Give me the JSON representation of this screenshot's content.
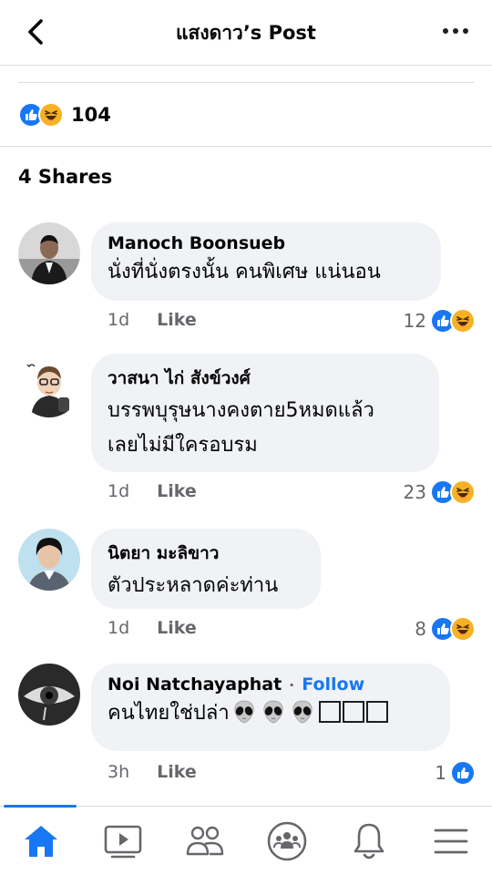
{
  "header": {
    "title": "แสงดาว’s Post",
    "back_icon": "chevron-left-icon",
    "more_icon": "more-horizontal-icon"
  },
  "post": {
    "reaction_count": "104",
    "reaction_types": [
      "like",
      "haha"
    ],
    "shares_label": "4 Shares"
  },
  "comments": [
    {
      "author": "Manoch Boonsueb",
      "lines": [
        "นั่งที่นั่งตรงนั้น คนพิเศษ แน่นอน"
      ],
      "time": "1d",
      "like_label": "Like",
      "reaction_count": "12",
      "reaction_types": [
        "like",
        "haha"
      ]
    },
    {
      "author": "วาสนา ไก่ สังข์วงศ์",
      "lines": [
        "บรรพบุรุษนางคงตาย5หมดแล้ว",
        "เลยไม่มีใครอบรม"
      ],
      "time": "1d",
      "like_label": "Like",
      "reaction_count": "23",
      "reaction_types": [
        "like",
        "haha"
      ]
    },
    {
      "author": "นิตยา มะลิขาว",
      "lines": [
        "ตัวประหลาดค่ะท่าน"
      ],
      "time": "1d",
      "like_label": "Like",
      "reaction_count": "8",
      "reaction_types": [
        "like",
        "haha"
      ]
    },
    {
      "author": "Noi Natchayaphat",
      "follow_label": "Follow",
      "text": "คนไทยใช่ปล่า",
      "emoji": [
        "alien-emoji",
        "alien-emoji",
        "alien-emoji",
        "missing-glyph-box",
        "missing-glyph-box",
        "missing-glyph-box"
      ],
      "time": "3h",
      "like_label": "Like",
      "reaction_count": "1",
      "reaction_types": [
        "like"
      ]
    }
  ],
  "tabbar": {
    "items": [
      "home-icon",
      "watch-icon",
      "friends-icon",
      "groups-icon",
      "notifications-icon",
      "menu-icon"
    ],
    "active": "home-icon"
  },
  "colors": {
    "accent": "#1877f2",
    "bubble": "#f0f2f5",
    "secondary_text": "#65676b",
    "haha": "#f7b125"
  }
}
